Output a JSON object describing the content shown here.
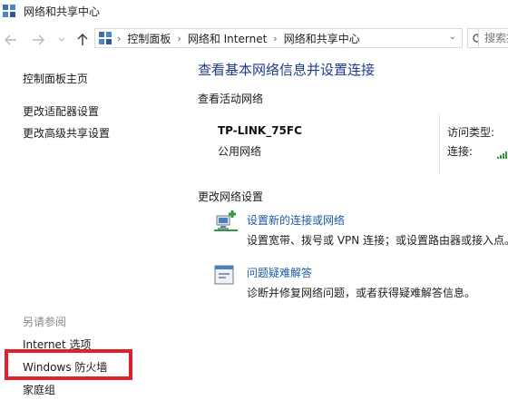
{
  "window": {
    "title": "网络和共享中心"
  },
  "address_bar": {
    "crumbs": [
      "控制面板",
      "网络和 Internet",
      "网络和共享中心"
    ],
    "search_placeholder": "搜索控"
  },
  "sidebar": {
    "home": "控制面板主页",
    "adapter": "更改适配器设置",
    "advanced": "更改高级共享设置",
    "see_also": "另请参阅",
    "internet_options": "Internet 选项",
    "firewall": "Windows 防火墙",
    "homegroup": "家庭组"
  },
  "main": {
    "title": "查看基本网络信息并设置连接",
    "active_label": "查看活动网络",
    "network_name": "TP-LINK_75FC",
    "network_type": "公用网络",
    "access_type_label": "访问类型:",
    "connection_label": "连接:",
    "change_label": "更改网络设置",
    "tasks": [
      {
        "title": "设置新的连接或网络",
        "desc": "设置宽带、拨号或 VPN 连接；或设置路由器或接入点。"
      },
      {
        "title": "问题疑难解答",
        "desc": "诊断并修复网络问题，或者获得疑难解答信息。"
      }
    ]
  },
  "colors": {
    "link": "#1d5aa8",
    "title": "#1e3c8c",
    "highlight": "#e0202a"
  }
}
